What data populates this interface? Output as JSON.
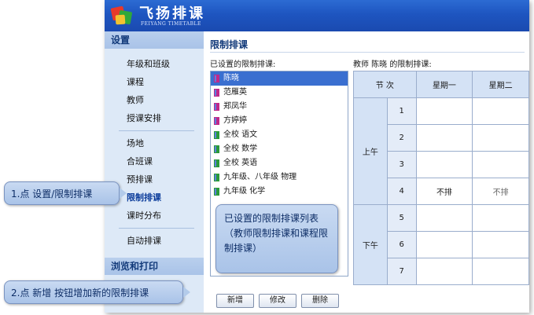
{
  "app": {
    "title": "飞扬排课",
    "subtitle": "FEIYANG TIMETABLE"
  },
  "sidebar": {
    "section1": "设置",
    "items": [
      {
        "label": "年级和班级"
      },
      {
        "label": "课程"
      },
      {
        "label": "教师"
      },
      {
        "label": "授课安排"
      },
      {
        "label": "场地"
      },
      {
        "label": "合班课"
      },
      {
        "label": "预排课"
      },
      {
        "label": "限制排课",
        "active": true
      },
      {
        "label": "课时分布"
      },
      {
        "label": "自动排课"
      }
    ],
    "section2": "浏览和打印"
  },
  "main": {
    "title": "限制排课",
    "list_label": "已设置的限制排课:",
    "list_items": [
      {
        "label": "陈晓",
        "icon": "teacher-icon",
        "selected": true
      },
      {
        "label": "范雁英",
        "icon": "teacher-icon"
      },
      {
        "label": "郑凤华",
        "icon": "teacher-icon"
      },
      {
        "label": "方婷婷",
        "icon": "teacher-icon"
      },
      {
        "label": "全校 语文",
        "icon": "course-icon"
      },
      {
        "label": "全校 数学",
        "icon": "course-icon"
      },
      {
        "label": "全校 英语",
        "icon": "course-icon"
      },
      {
        "label": "九年级、八年级 物理",
        "icon": "course-icon"
      },
      {
        "label": "九年级 化学",
        "icon": "course-icon"
      }
    ],
    "buttons": {
      "add": "新增",
      "edit": "修改",
      "delete": "删除"
    },
    "table_label": "教师 陈晓 的限制排课:",
    "table": {
      "header_period": "节 次",
      "header_days": [
        "星期一",
        "星期二"
      ],
      "morning": "上午",
      "afternoon": "下午",
      "periods": [
        "1",
        "2",
        "3",
        "4",
        "5",
        "6",
        "7"
      ],
      "cell_no": "不排"
    }
  },
  "callouts": {
    "step1": "1.点 设置/限制排课",
    "step2": "2.点 新增 按钮增加新的限制排课",
    "list_note": "已设置的限制排课列表（教师限制排课和课程限制排课）"
  },
  "colors": {
    "header_blue": "#1e55c0",
    "sidebar_bg": "#dde9f7",
    "selected": "#3a6fd0",
    "teacher_icon": "#c0288a",
    "course_icon": "#2a9a3a"
  }
}
